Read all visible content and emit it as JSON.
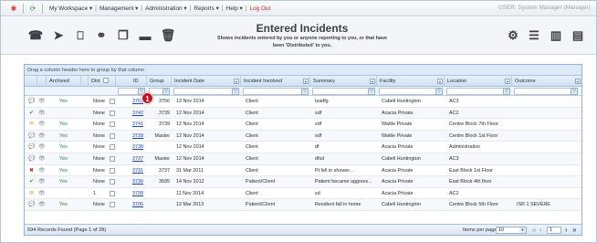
{
  "topbar": {
    "menu": [
      "My Workspace",
      "Management",
      "Administration",
      "Reports",
      "Help",
      "Log Out"
    ],
    "user": "USER: System Manager (Manager)"
  },
  "header": {
    "title": "Entered Incidents",
    "subtitle_line1": "Shows incidents entered by you or anyone reporting to you, or that have",
    "subtitle_line2": "been 'Distributed' to you."
  },
  "grid": {
    "group_hint": "Drag a column header here to group by that column",
    "columns": [
      "Archived",
      "Dist",
      "ID",
      "Group",
      "Incident Date",
      "Incident Involved",
      "Summary",
      "Facility",
      "Location",
      "Outcome"
    ],
    "filter_symbol": "▽",
    "rows": [
      {
        "icon": "chat",
        "archived": "Yes",
        "dist": "None",
        "id": "3763",
        "group": "3756",
        "date": "12 Nov 2014",
        "involved": "Client",
        "summary": "tsadfg",
        "facility": "Cabell Huntington",
        "location": "AC3",
        "outcome": ""
      },
      {
        "icon": "check",
        "archived": "",
        "dist": "None",
        "id": "3742",
        "group": "3739",
        "date": "12 Nov 2014",
        "involved": "Client",
        "summary": "sdf",
        "facility": "Acacia Private",
        "location": "AC2",
        "outcome": ""
      },
      {
        "icon": "mail",
        "archived": "Yes",
        "dist": "None",
        "id": "3741",
        "group": "3739",
        "date": "12 Nov 2014",
        "involved": "Client",
        "summary": "sdf",
        "facility": "Wattle Private",
        "location": "Centre Block 7th Floor",
        "outcome": ""
      },
      {
        "icon": "chat",
        "archived": "Yes",
        "dist": "None",
        "id": "3739",
        "group": "Master",
        "date": "12 Nov 2014",
        "involved": "Client",
        "summary": "sdf",
        "facility": "Wattle Private",
        "location": "Centre Block 1st Floor",
        "outcome": ""
      },
      {
        "icon": "chat",
        "archived": "Yes",
        "dist": "None",
        "id": "3738",
        "group": "",
        "date": "12 Nov 2014",
        "involved": "Client",
        "summary": "df",
        "facility": "Acacia Private",
        "location": "Administration",
        "outcome": ""
      },
      {
        "icon": "chat",
        "archived": "Yes",
        "dist": "None",
        "id": "3737",
        "group": "Master",
        "date": "12 Nov 2014",
        "involved": "Client",
        "summary": "dfsd",
        "facility": "Cabell Huntington",
        "location": "AC3",
        "outcome": ""
      },
      {
        "icon": "cross",
        "archived": "Yes",
        "dist": "None",
        "id": "3731",
        "group": "3737",
        "date": "31 Mar 2011",
        "involved": "Client",
        "summary": "Pt fell in shower...",
        "facility": "Acacia Private",
        "location": "East Block 1st Floor",
        "outcome": ""
      },
      {
        "icon": "check",
        "archived": "Yes",
        "dist": "None",
        "id": "3730",
        "group": "3695",
        "date": "14 Nov 2012",
        "involved": "Patient/Client",
        "summary": "Patient became aggress...",
        "facility": "Acacia Private",
        "location": "East Block 4th floor",
        "outcome": ""
      },
      {
        "icon": "mail",
        "archived": "",
        "dist": "1",
        "id": "3708",
        "group": "",
        "date": "11 Nov 2014",
        "involved": "Client",
        "summary": "sd",
        "facility": "Acacia Private",
        "location": "AC2",
        "outcome": ""
      },
      {
        "icon": "chat",
        "archived": "Yes",
        "dist": "None",
        "id": "3706",
        "group": "",
        "date": "12 Mar 2013",
        "involved": "Patient/Client",
        "summary": "Resident fall in home",
        "facility": "Cabell Huntington",
        "location": "Centre Block 5th Floor",
        "outcome": "ISR 1 SEVERE"
      }
    ]
  },
  "pager": {
    "count": "594 Records Found (Page 1 of 28)",
    "per_page_label": "Items per page:",
    "per_page_value": "10",
    "page": "1"
  },
  "badge": "1",
  "colors": {
    "accent": "#1a42c8",
    "yes": "#1d8a3a",
    "logout": "#d21f1f",
    "badge": "#c1121f"
  }
}
